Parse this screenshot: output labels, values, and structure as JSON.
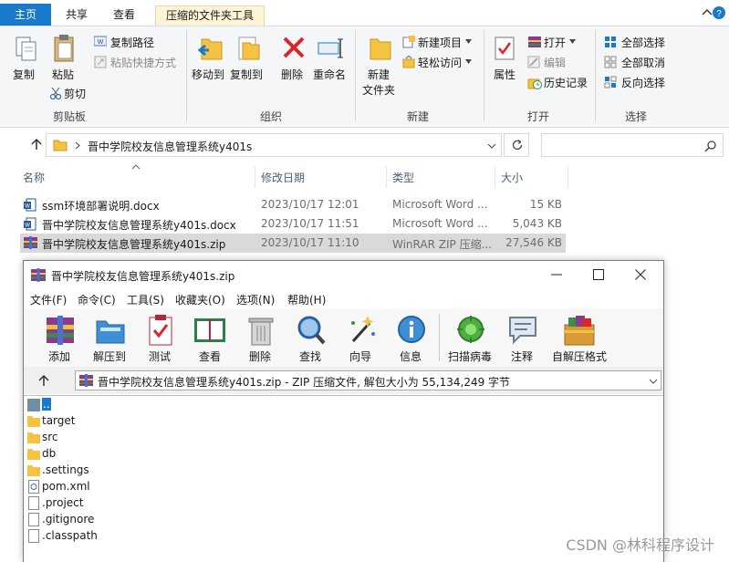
{
  "ribbon_tabs": {
    "home": "主页",
    "share": "共享",
    "view": "查看",
    "tools": "压缩的文件夹工具"
  },
  "ribbon": {
    "clipboard": {
      "copy": "复制",
      "paste": "粘贴",
      "copy_path": "复制路径",
      "paste_shortcut": "粘贴快捷方式",
      "cut": "剪切",
      "label": "剪贴板"
    },
    "organize": {
      "move_to": "移动到",
      "copy_to": "复制到",
      "delete": "删除",
      "rename": "重命名",
      "label": "组织"
    },
    "new": {
      "new_folder": "新建\n文件夹",
      "new_folder_l1": "新建",
      "new_folder_l2": "文件夹",
      "new_item": "新建项目",
      "easy_access": "轻松访问",
      "label": "新建"
    },
    "open": {
      "properties": "属性",
      "open": "打开",
      "edit": "编辑",
      "history": "历史记录",
      "label": "打开"
    },
    "select": {
      "select_all": "全部选择",
      "select_none": "全部取消",
      "invert": "反向选择",
      "label": "选择"
    }
  },
  "address": {
    "path": "晋中学院校友信息管理系统y401s",
    "search_placeholder": ""
  },
  "columns": {
    "name": "名称",
    "modified": "修改日期",
    "type": "类型",
    "size": "大小"
  },
  "files": [
    {
      "name": "ssm环境部署说明.docx",
      "date": "2023/10/17 12:01",
      "type": "Microsoft Word ...",
      "size": "15 KB"
    },
    {
      "name": "晋中学院校友信息管理系统y401s.docx",
      "date": "2023/10/17 11:51",
      "type": "Microsoft Word ...",
      "size": "5,043 KB"
    },
    {
      "name": "晋中学院校友信息管理系统y401s.zip",
      "date": "2023/10/17 11:10",
      "type": "WinRAR ZIP 压缩...",
      "size": "27,546 KB"
    }
  ],
  "rar": {
    "title": "晋中学院校友信息管理系统y401s.zip",
    "menu": [
      "文件(F)",
      "命令(C)",
      "工具(S)",
      "收藏夹(O)",
      "选项(N)",
      "帮助(H)"
    ],
    "tools": [
      "添加",
      "解压到",
      "测试",
      "查看",
      "删除",
      "查找",
      "向导",
      "信息",
      "扫描病毒",
      "注释",
      "自解压格式"
    ],
    "path_text": "晋中学院校友信息管理系统y401s.zip - ZIP 压缩文件, 解包大小为 55,134,249 字节",
    "entries": [
      "..",
      "target",
      "src",
      "db",
      ".settings",
      "pom.xml",
      ".project",
      ".gitignore",
      ".classpath"
    ]
  },
  "watermark": "CSDN @林科程序设计",
  "colors": {
    "accent": "#1979ca",
    "folder": "#f5c342",
    "selection": "#d9d9d9"
  }
}
